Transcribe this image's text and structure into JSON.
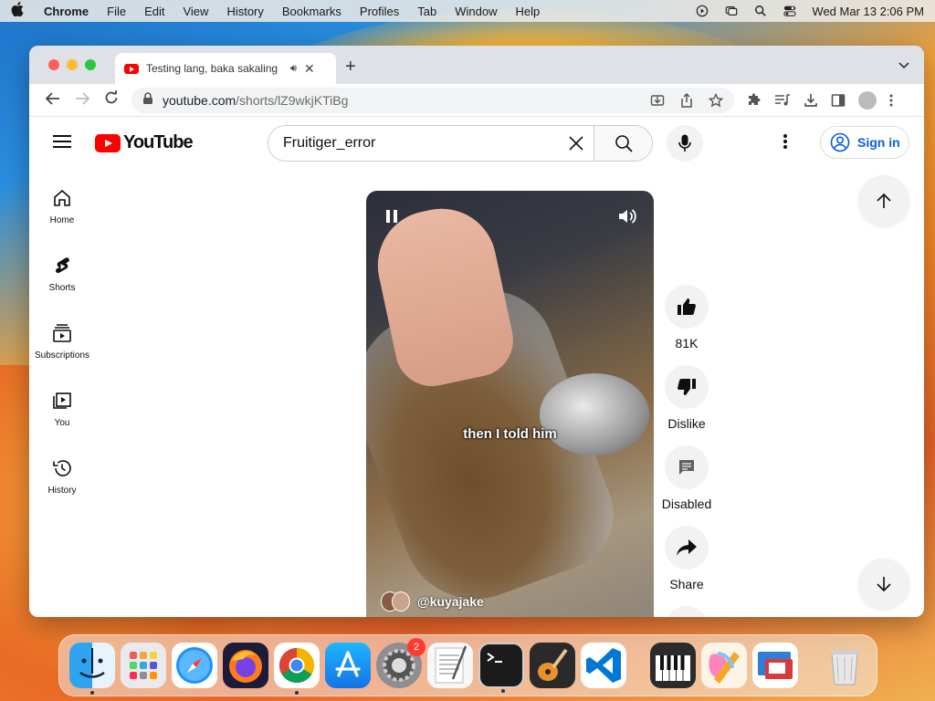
{
  "menubar": {
    "app": "Chrome",
    "items": [
      "File",
      "Edit",
      "View",
      "History",
      "Bookmarks",
      "Profiles",
      "Tab",
      "Window",
      "Help"
    ],
    "datetime": "Wed Mar 13  2:06 PM"
  },
  "browser": {
    "tab_title": "Testing lang, baka sakaling",
    "url_host": "youtube.com",
    "url_path": "/shorts/lZ9wkjKTiBg"
  },
  "youtube": {
    "logo_text": "YouTube",
    "search_value": "Fruitiger_error",
    "signin_label": "Sign in",
    "sidebar": [
      {
        "label": "Home",
        "icon": "home-icon"
      },
      {
        "label": "Shorts",
        "icon": "shorts-icon"
      },
      {
        "label": "Subscriptions",
        "icon": "subscriptions-icon"
      },
      {
        "label": "You",
        "icon": "you-icon"
      },
      {
        "label": "History",
        "icon": "history-icon"
      }
    ],
    "video": {
      "caption": "then I told him",
      "channel": "@kuyajake"
    },
    "actions": {
      "like_count": "81K",
      "dislike_label": "Dislike",
      "comments_label": "Disabled",
      "share_label": "Share"
    }
  },
  "dock": {
    "apps": [
      "Finder",
      "Launchpad",
      "Safari",
      "Firefox",
      "Chrome",
      "App Store",
      "System Settings",
      "TextEdit",
      "Terminal",
      "GarageBand",
      "Visual Studio Code",
      "Piano",
      "Pages",
      "Remote Desktop",
      "Trash"
    ],
    "settings_badge": "2"
  },
  "colors": {
    "youtube_red": "#ff0000",
    "link_blue": "#065fd4"
  }
}
